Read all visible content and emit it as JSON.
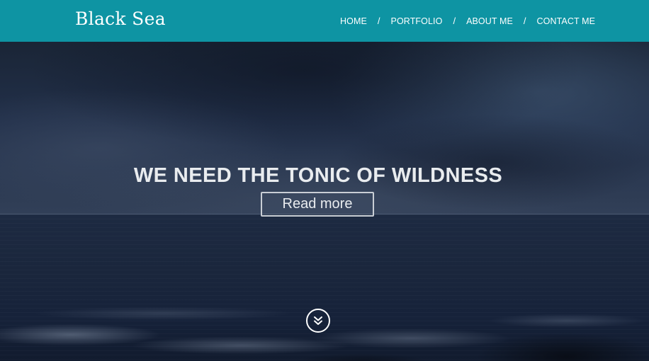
{
  "brand": {
    "logo_text": "Black Sea",
    "color": "#0e94a3"
  },
  "nav": {
    "items": [
      {
        "label": "HOME"
      },
      {
        "label": "PORTFOLIO"
      },
      {
        "label": "ABOUT ME"
      },
      {
        "label": "CONTACT ME"
      }
    ],
    "separator": "/"
  },
  "hero": {
    "headline": "WE NEED THE TONIC OF WILDNESS",
    "button_label": "Read more",
    "scroll_icon": "double-chevron-down-icon"
  }
}
